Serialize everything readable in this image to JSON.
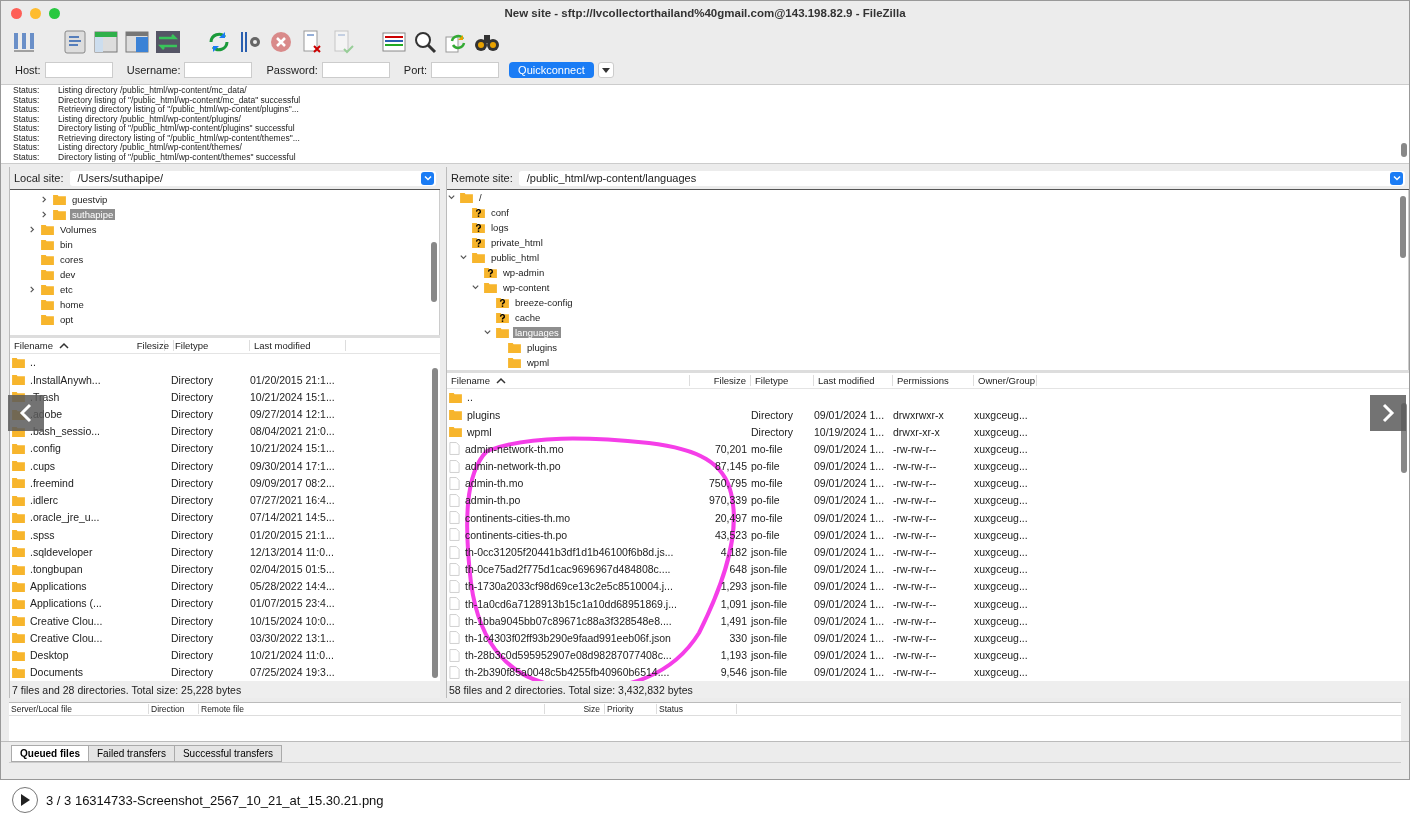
{
  "window": {
    "title": "New site - sftp://lvcollectorthailand%40gmail.com@143.198.82.9 - FileZilla"
  },
  "quickconnect": {
    "fields": [
      {
        "label": "Host:"
      },
      {
        "label": "Username:"
      },
      {
        "label": "Password:"
      },
      {
        "label": "Port:"
      }
    ],
    "button": "Quickconnect"
  },
  "log": [
    {
      "label": "Status:",
      "message": "Listing directory /public_html/wp-content/mc_data/"
    },
    {
      "label": "Status:",
      "message": "Directory listing of \"/public_html/wp-content/mc_data\" successful"
    },
    {
      "label": "Status:",
      "message": "Retrieving directory listing of \"/public_html/wp-content/plugins\"..."
    },
    {
      "label": "Status:",
      "message": "Listing directory /public_html/wp-content/plugins/"
    },
    {
      "label": "Status:",
      "message": "Directory listing of \"/public_html/wp-content/plugins\" successful"
    },
    {
      "label": "Status:",
      "message": "Retrieving directory listing of \"/public_html/wp-content/themes\"..."
    },
    {
      "label": "Status:",
      "message": "Listing directory /public_html/wp-content/themes/"
    },
    {
      "label": "Status:",
      "message": "Directory listing of \"/public_html/wp-content/themes\" successful"
    }
  ],
  "local": {
    "site_label": "Local site:",
    "path": "/Users/suthapipe/",
    "tree": [
      {
        "children": [
          {
            "label": "guestvip",
            "kind": "folder",
            "expandable": true,
            "expanded": false,
            "selected": false
          },
          {
            "label": "suthapipe",
            "kind": "folder",
            "expandable": true,
            "expanded": false,
            "selected": true
          }
        ]
      },
      {
        "label": "Volumes",
        "kind": "folder",
        "expandable": true,
        "expanded": false,
        "selected": false
      },
      {
        "label": "bin",
        "kind": "folder",
        "expandable": false,
        "selected": false
      },
      {
        "label": "cores",
        "kind": "folder",
        "expandable": false,
        "selected": false
      },
      {
        "label": "dev",
        "kind": "folder",
        "expandable": false,
        "selected": false
      },
      {
        "label": "etc",
        "kind": "folder",
        "expandable": true,
        "expanded": false,
        "selected": false
      },
      {
        "label": "home",
        "kind": "folder",
        "expandable": false,
        "selected": false
      },
      {
        "label": "opt",
        "kind": "folder",
        "expandable": false,
        "selected": false
      }
    ],
    "columns": [
      "Filename",
      "Filesize",
      "Filetype",
      "Last modified"
    ],
    "rows": [
      {
        "kind": "folder",
        "name": ".."
      },
      {
        "kind": "folder",
        "name": ".InstallAnywh...",
        "type": "Directory",
        "modified": "01/20/2015 21:1..."
      },
      {
        "kind": "folder",
        "name": ".Trash",
        "type": "Directory",
        "modified": "10/21/2024 15:1..."
      },
      {
        "kind": "folder",
        "name": ".adobe",
        "type": "Directory",
        "modified": "09/27/2014 12:1..."
      },
      {
        "kind": "folder",
        "name": ".bash_sessio...",
        "type": "Directory",
        "modified": "08/04/2021 21:0..."
      },
      {
        "kind": "folder",
        "name": ".config",
        "type": "Directory",
        "modified": "10/21/2024 15:1..."
      },
      {
        "kind": "folder",
        "name": ".cups",
        "type": "Directory",
        "modified": "09/30/2014 17:1..."
      },
      {
        "kind": "folder",
        "name": ".freemind",
        "type": "Directory",
        "modified": "09/09/2017 08:2..."
      },
      {
        "kind": "folder",
        "name": ".idlerc",
        "type": "Directory",
        "modified": "07/27/2021 16:4..."
      },
      {
        "kind": "folder",
        "name": ".oracle_jre_u...",
        "type": "Directory",
        "modified": "07/14/2021 14:5..."
      },
      {
        "kind": "folder",
        "name": ".spss",
        "type": "Directory",
        "modified": "01/20/2015 21:1..."
      },
      {
        "kind": "folder",
        "name": ".sqldeveloper",
        "type": "Directory",
        "modified": "12/13/2014 11:0..."
      },
      {
        "kind": "folder",
        "name": ".tongbupan",
        "type": "Directory",
        "modified": "02/04/2015 01:5..."
      },
      {
        "kind": "folder",
        "name": "Applications",
        "type": "Directory",
        "modified": "05/28/2022 14:4..."
      },
      {
        "kind": "folder",
        "name": "Applications (...",
        "type": "Directory",
        "modified": "01/07/2015 23:4..."
      },
      {
        "kind": "folder",
        "name": "Creative Clou...",
        "type": "Directory",
        "modified": "10/15/2024 10:0..."
      },
      {
        "kind": "folder",
        "name": "Creative Clou...",
        "type": "Directory",
        "modified": "03/30/2022 13:1..."
      },
      {
        "kind": "folder",
        "name": "Desktop",
        "type": "Directory",
        "modified": "10/21/2024 11:0..."
      },
      {
        "kind": "folder",
        "name": "Documents",
        "type": "Directory",
        "modified": "07/25/2024 19:3..."
      }
    ],
    "status": "7 files and 28 directories. Total size: 25,228 bytes"
  },
  "remote": {
    "site_label": "Remote site:",
    "path": "/public_html/wp-content/languages",
    "tree": [
      {
        "label": "/",
        "kind": "folder",
        "expandable": true,
        "expanded": true,
        "selected": false,
        "children": [
          {
            "label": "conf",
            "kind": "unknown",
            "expandable": false,
            "selected": false
          },
          {
            "label": "logs",
            "kind": "unknown",
            "expandable": false,
            "selected": false
          },
          {
            "label": "private_html",
            "kind": "unknown",
            "expandable": false,
            "selected": false
          },
          {
            "label": "public_html",
            "kind": "folder",
            "expandable": true,
            "expanded": true,
            "selected": false,
            "children": [
              {
                "label": "wp-admin",
                "kind": "unknown",
                "expandable": false,
                "selected": false
              },
              {
                "label": "wp-content",
                "kind": "folder",
                "expandable": true,
                "expanded": true,
                "selected": false,
                "children": [
                  {
                    "label": "breeze-config",
                    "kind": "unknown",
                    "expandable": false,
                    "selected": false
                  },
                  {
                    "label": "cache",
                    "kind": "unknown",
                    "expandable": false,
                    "selected": false
                  },
                  {
                    "label": "languages",
                    "kind": "folder",
                    "expandable": true,
                    "expanded": true,
                    "selected": true,
                    "children": [
                      {
                        "label": "plugins",
                        "kind": "folder",
                        "expandable": false,
                        "selected": false
                      },
                      {
                        "label": "wpml",
                        "kind": "folder",
                        "expandable": false,
                        "selected": false
                      }
                    ]
                  }
                ]
              }
            ]
          }
        ]
      }
    ],
    "columns": [
      "Filename",
      "Filesize",
      "Filetype",
      "Last modified",
      "Permissions",
      "Owner/Group"
    ],
    "rows": [
      {
        "kind": "folder",
        "name": ".."
      },
      {
        "kind": "folder",
        "name": "plugins",
        "type": "Directory",
        "modified": "09/01/2024 1...",
        "permissions": "drwxrwxr-x",
        "owner": "xuxgceug..."
      },
      {
        "kind": "folder",
        "name": "wpml",
        "type": "Directory",
        "modified": "10/19/2024 1...",
        "permissions": "drwxr-xr-x",
        "owner": "xuxgceug..."
      },
      {
        "kind": "file",
        "name": "admin-network-th.mo",
        "size": "70,201",
        "type": "mo-file",
        "modified": "09/01/2024 1...",
        "permissions": "-rw-rw-r--",
        "owner": "xuxgceug..."
      },
      {
        "kind": "file",
        "name": "admin-network-th.po",
        "size": "87,145",
        "type": "po-file",
        "modified": "09/01/2024 1...",
        "permissions": "-rw-rw-r--",
        "owner": "xuxgceug..."
      },
      {
        "kind": "file",
        "name": "admin-th.mo",
        "size": "750,795",
        "type": "mo-file",
        "modified": "09/01/2024 1...",
        "permissions": "-rw-rw-r--",
        "owner": "xuxgceug..."
      },
      {
        "kind": "file",
        "name": "admin-th.po",
        "size": "970,339",
        "type": "po-file",
        "modified": "09/01/2024 1...",
        "permissions": "-rw-rw-r--",
        "owner": "xuxgceug..."
      },
      {
        "kind": "file",
        "name": "continents-cities-th.mo",
        "size": "20,497",
        "type": "mo-file",
        "modified": "09/01/2024 1...",
        "permissions": "-rw-rw-r--",
        "owner": "xuxgceug..."
      },
      {
        "kind": "file",
        "name": "continents-cities-th.po",
        "size": "43,523",
        "type": "po-file",
        "modified": "09/01/2024 1...",
        "permissions": "-rw-rw-r--",
        "owner": "xuxgceug..."
      },
      {
        "kind": "file",
        "name": "th-0cc31205f20441b3df1d1b46100f6b8d.js...",
        "size": "4,182",
        "type": "json-file",
        "modified": "09/01/2024 1...",
        "permissions": "-rw-rw-r--",
        "owner": "xuxgceug..."
      },
      {
        "kind": "file",
        "name": "th-0ce75ad2f775d1cac9696967d484808c....",
        "size": "648",
        "type": "json-file",
        "modified": "09/01/2024 1...",
        "permissions": "-rw-rw-r--",
        "owner": "xuxgceug..."
      },
      {
        "kind": "file",
        "name": "th-1730a2033cf98d69ce13c2e5c8510004.j...",
        "size": "1,293",
        "type": "json-file",
        "modified": "09/01/2024 1...",
        "permissions": "-rw-rw-r--",
        "owner": "xuxgceug..."
      },
      {
        "kind": "file",
        "name": "th-1a0cd6a7128913b15c1a10dd68951869.j...",
        "size": "1,091",
        "type": "json-file",
        "modified": "09/01/2024 1...",
        "permissions": "-rw-rw-r--",
        "owner": "xuxgceug..."
      },
      {
        "kind": "file",
        "name": "th-1bba9045bb07c89671c88a3f328548e8....",
        "size": "1,491",
        "type": "json-file",
        "modified": "09/01/2024 1...",
        "permissions": "-rw-rw-r--",
        "owner": "xuxgceug..."
      },
      {
        "kind": "file",
        "name": "th-1c4303f02ff93b290e9faad991eeb06f.json",
        "size": "330",
        "type": "json-file",
        "modified": "09/01/2024 1...",
        "permissions": "-rw-rw-r--",
        "owner": "xuxgceug..."
      },
      {
        "kind": "file",
        "name": "th-28b3c0d595952907e08d98287077408c...",
        "size": "1,193",
        "type": "json-file",
        "modified": "09/01/2024 1...",
        "permissions": "-rw-rw-r--",
        "owner": "xuxgceug..."
      },
      {
        "kind": "file",
        "name": "th-2b390f85a0048c5b4255fb40960b6514....",
        "size": "9,546",
        "type": "json-file",
        "modified": "09/01/2024 1...",
        "permissions": "-rw-rw-r--",
        "owner": "xuxgceug..."
      }
    ],
    "status": "58 files and 2 directories. Total size: 3,432,832 bytes"
  },
  "queue": {
    "columns": [
      "Server/Local file",
      "Direction",
      "Remote file",
      "Size",
      "Priority",
      "Status"
    ],
    "tabs": [
      {
        "label": "Queued files",
        "selected": true
      },
      {
        "label": "Failed transfers",
        "selected": false
      },
      {
        "label": "Successful transfers",
        "selected": false
      }
    ]
  },
  "viewer": {
    "caption": "3 / 3 16314733-Screenshot_2567_10_21_at_15.30.21.png"
  }
}
